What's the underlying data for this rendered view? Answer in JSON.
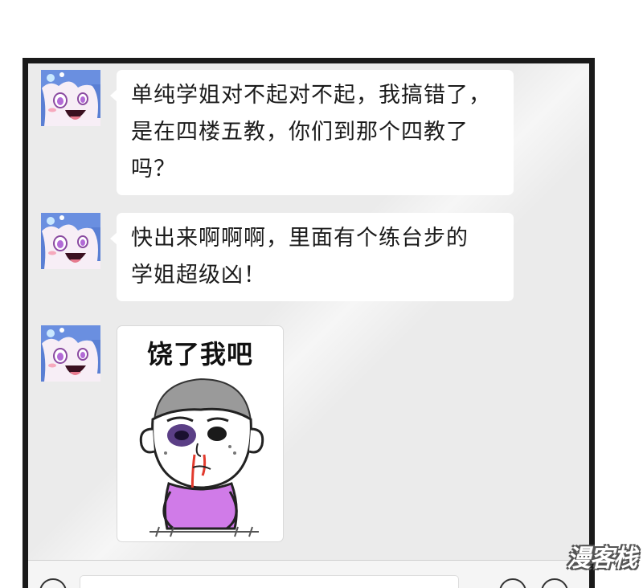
{
  "messages": [
    {
      "sender": "avatar-anime-girl",
      "type": "text",
      "lines": [
        "单纯学姐对不起对不起，我搞错了，",
        "是在四楼五教，你们到那个四教了",
        "吗？"
      ]
    },
    {
      "sender": "avatar-anime-girl",
      "type": "text",
      "lines": [
        "快出来啊啊啊，里面有个练台步的",
        "学姐超级凶！"
      ]
    },
    {
      "sender": "avatar-anime-girl",
      "type": "sticker",
      "caption": "饶了我吧",
      "image": "beaten-cartoon-boy"
    }
  ],
  "watermark": "漫客栈",
  "colors": {
    "chat_background": "#ebebeb",
    "bubble": "#ffffff",
    "frame": "#1a1a1a",
    "avatar_hair": "#6a8fe0",
    "sticker_shirt": "#d07be8",
    "bruise": "#5b3f86",
    "blood": "#e23b2e"
  }
}
